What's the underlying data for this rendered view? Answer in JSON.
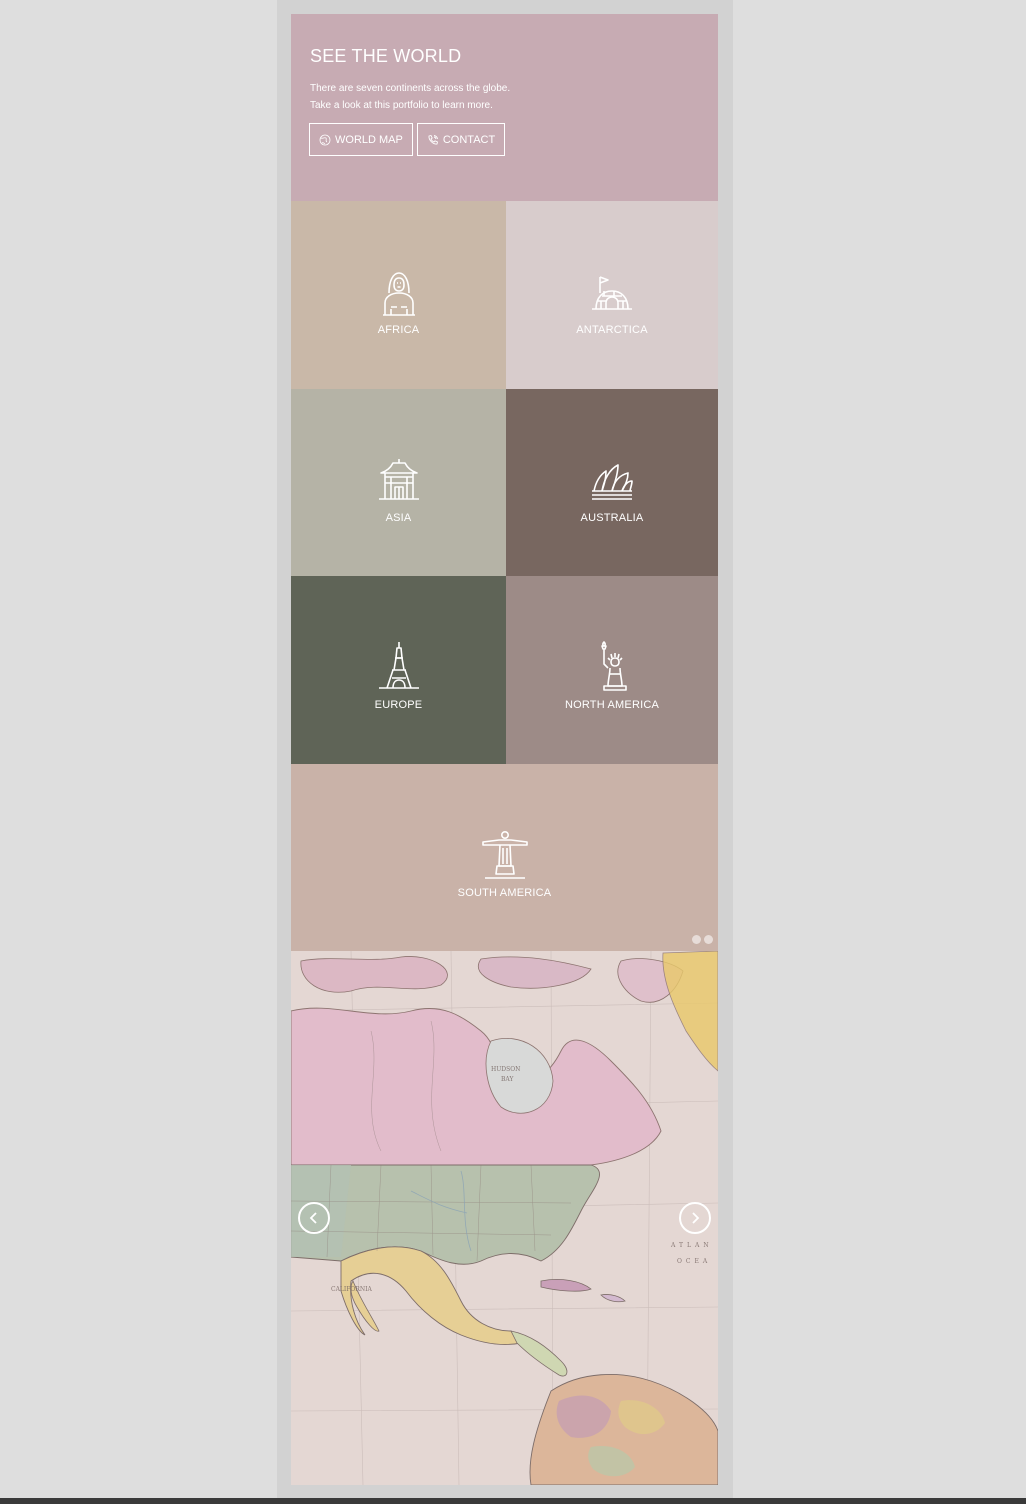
{
  "hero": {
    "title": "SEE THE WORLD",
    "desc_line1": "There are seven continents across the globe.",
    "desc_line2": "Take a look at this portfolio to learn more.",
    "buttons": [
      {
        "label": "WORLD MAP",
        "icon": "globe-icon"
      },
      {
        "label": "CONTACT",
        "icon": "phone-icon"
      }
    ]
  },
  "continents": [
    {
      "label": "AFRICA",
      "icon": "sphinx-icon",
      "color": "#c9b8a8"
    },
    {
      "label": "ANTARCTICA",
      "icon": "igloo-icon",
      "color": "#d8cccc"
    },
    {
      "label": "ASIA",
      "icon": "pagoda-icon",
      "color": "#b5b3a6"
    },
    {
      "label": "AUSTRALIA",
      "icon": "opera-house-icon",
      "color": "#786760"
    },
    {
      "label": "EUROPE",
      "icon": "eiffel-tower-icon",
      "color": "#5f6457"
    },
    {
      "label": "NORTH AMERICA",
      "icon": "statue-of-liberty-icon",
      "color": "#9d8b87"
    },
    {
      "label": "SOUTH AMERICA",
      "icon": "christ-redeemer-icon",
      "color": "#c9b2a8"
    }
  ],
  "slider": {
    "dot_count": 2,
    "prev_icon": "chevron-left-icon",
    "next_icon": "chevron-right-icon"
  },
  "colors": {
    "hero_bg": "#c7abb3",
    "frame_bg": "#d2d2d2",
    "page_bg": "#dedede"
  }
}
